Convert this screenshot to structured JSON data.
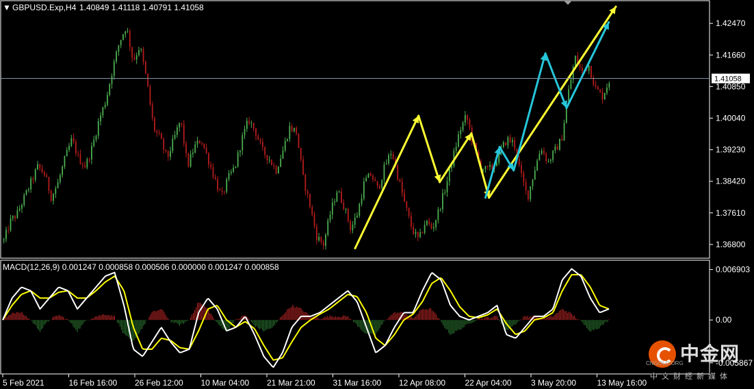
{
  "header": {
    "symbol": "GBPUSD.Exp,H4",
    "ohlc": "1.40849 1.41118 1.40791 1.41058"
  },
  "macd_header": "MACD(12,26,9) 0.001247 0.000858 0.000506 0.000000 0.001247 0.000858",
  "current_price_label": "1.41058",
  "colors": {
    "bull": "#4caf50",
    "bear": "#b71c1c",
    "macd_line": "#ffffff",
    "signal_line": "#ffff00",
    "arrow_yellow": "#ffff33",
    "arrow_cyan": "#26c6da",
    "price_line": "#7f93a8"
  },
  "chart_data": [
    {
      "type": "candlestick",
      "name": "price",
      "ylim": [
        1.365,
        1.43
      ],
      "y_ticks": [
        1.4247,
        1.4166,
        1.4085,
        1.4004,
        1.3923,
        1.3842,
        1.3761,
        1.368
      ],
      "current_price": 1.41058,
      "x_ticks": [
        "5 Feb 2021",
        "16 Feb 16:00",
        "26 Feb 12:00",
        "10 Mar 04:00",
        "21 Mar 21:00",
        "31 Mar 16:00",
        "12 Apr 08:00",
        "22 Apr 04:00",
        "3 May 20:00",
        "13 May 16:00"
      ],
      "close_path": [
        1.369,
        1.374,
        1.376,
        1.38,
        1.384,
        1.388,
        1.386,
        1.38,
        1.384,
        1.39,
        1.395,
        1.39,
        1.388,
        1.393,
        1.4,
        1.405,
        1.413,
        1.42,
        1.424,
        1.415,
        1.419,
        1.41,
        1.398,
        1.395,
        1.39,
        1.395,
        1.4,
        1.388,
        1.393,
        1.395,
        1.39,
        1.385,
        1.38,
        1.385,
        1.388,
        1.395,
        1.4,
        1.397,
        1.392,
        1.39,
        1.387,
        1.392,
        1.398,
        1.397,
        1.385,
        1.378,
        1.37,
        1.368,
        1.376,
        1.382,
        1.378,
        1.372,
        1.376,
        1.384,
        1.386,
        1.382,
        1.388,
        1.392,
        1.385,
        1.378,
        1.372,
        1.369,
        1.374,
        1.372,
        1.377,
        1.383,
        1.39,
        1.397,
        1.401,
        1.394,
        1.388,
        1.387,
        1.388,
        1.392,
        1.395,
        1.394,
        1.386,
        1.38,
        1.387,
        1.393,
        1.389,
        1.392,
        1.395,
        1.407,
        1.416,
        1.412,
        1.414,
        1.408,
        1.406,
        1.41
      ],
      "annotations": {
        "yellow_lines": [
          {
            "from": [
              0.5,
              1.367
            ],
            "to": [
              0.59,
              1.401
            ]
          },
          {
            "from": [
              0.59,
              1.401
            ],
            "to": [
              0.62,
              1.384
            ]
          },
          {
            "from": [
              0.62,
              1.384
            ],
            "to": [
              0.665,
              1.3965
            ]
          },
          {
            "from": [
              0.665,
              1.3965
            ],
            "to": [
              0.69,
              1.38
            ]
          },
          {
            "from": [
              0.69,
              1.38
            ],
            "to": [
              0.87,
              1.429
            ]
          }
        ],
        "cyan_lines": [
          {
            "from": [
              0.685,
              1.38
            ],
            "to": [
              0.705,
              1.393
            ]
          },
          {
            "from": [
              0.705,
              1.393
            ],
            "to": [
              0.725,
              1.387
            ]
          },
          {
            "from": [
              0.725,
              1.387
            ],
            "to": [
              0.77,
              1.417
            ]
          },
          {
            "from": [
              0.77,
              1.417
            ],
            "to": [
              0.8,
              1.403
            ]
          },
          {
            "from": [
              0.8,
              1.403
            ],
            "to": [
              0.86,
              1.425
            ]
          }
        ]
      }
    },
    {
      "type": "histogram+line",
      "name": "MACD(12,26,9)",
      "y_ticks": [
        0.006903,
        0.0,
        -0.005867
      ],
      "y_tick_labels": [
        "0.006903",
        "0.00",
        "-0.005867"
      ],
      "ylim": [
        -0.0072,
        0.0078
      ],
      "macd_path": [
        0.0,
        0.003,
        0.0045,
        0.004,
        0.0015,
        0.003,
        0.0045,
        0.004,
        0.0015,
        0.003,
        0.0045,
        0.006,
        0.0065,
        0.002,
        -0.004,
        -0.005,
        -0.003,
        -0.001,
        -0.003,
        -0.0045,
        -0.004,
        0.001,
        0.003,
        0.0015,
        -0.0015,
        -0.001,
        0.0005,
        -0.002,
        -0.005,
        -0.0065,
        -0.0045,
        -0.001,
        0.0005,
        0.0005,
        0.001,
        0.002,
        0.003,
        0.004,
        0.0025,
        -0.001,
        -0.0045,
        -0.0035,
        -0.001,
        0.001,
        0.001,
        0.004,
        0.0065,
        0.0055,
        0.002,
        0.0005,
        0.0,
        0.0005,
        0.001,
        0.002,
        -0.002,
        -0.0025,
        -0.001,
        0.0005,
        0.0005,
        0.0015,
        0.0055,
        0.007,
        0.006,
        0.003,
        0.001,
        0.0015
      ],
      "signal_path": [
        0.0,
        0.002,
        0.0035,
        0.004,
        0.003,
        0.003,
        0.0038,
        0.004,
        0.003,
        0.003,
        0.004,
        0.0052,
        0.006,
        0.004,
        -0.001,
        -0.004,
        -0.004,
        -0.0025,
        -0.0028,
        -0.0038,
        -0.004,
        -0.0015,
        0.0015,
        0.002,
        0.0,
        -0.001,
        -0.0002,
        -0.0012,
        -0.0035,
        -0.0055,
        -0.0052,
        -0.003,
        -0.001,
        0.0,
        0.0008,
        0.0015,
        0.0025,
        0.0035,
        0.0032,
        0.001,
        -0.0025,
        -0.0035,
        -0.002,
        0.0,
        0.0008,
        0.0025,
        0.005,
        0.0058,
        0.004,
        0.0018,
        0.0005,
        0.0003,
        0.0007,
        0.0015,
        -0.0005,
        -0.002,
        -0.0015,
        0.0,
        0.0003,
        0.001,
        0.004,
        0.0062,
        0.0062,
        0.0045,
        0.002,
        0.0015
      ]
    }
  ]
}
